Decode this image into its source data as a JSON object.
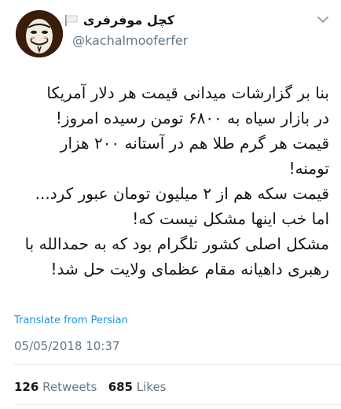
{
  "header": {
    "display_name": "کچل موفرفری",
    "handle": "@kachalmooferfer",
    "avatar_icon": "guy-fawkes-mask-icon",
    "flag_icon": "white-flag-icon",
    "menu_icon": "chevron-down-icon"
  },
  "tweet": {
    "lines": [
      "بنا بر گزارشات میدانی قیمت هر دلار آمریکا",
      "در بازار سیاه به ۶۸۰۰ تومن رسیده امروز!",
      "قیمت هر گرم طلا هم در آستانه ۲۰۰ هزار",
      "تومنه!",
      "قیمت سکه هم از ۲ میلیون تومان عبور کرد...",
      "اما خب اینها مشکل نیست که!",
      "مشکل اصلی کشور تلگرام بود که به حمدالله با",
      "رهبری داهیانه مقام عظمای ولایت حل شد!"
    ],
    "translate_label": "Translate from Persian",
    "timestamp": "05/05/2018 10:37"
  },
  "stats": {
    "retweets_count": "126",
    "retweets_label": "Retweets",
    "likes_count": "685",
    "likes_label": "Likes"
  },
  "colors": {
    "link": "#1b95e0",
    "secondary_text": "#657786",
    "divider": "#e6ecf0"
  }
}
